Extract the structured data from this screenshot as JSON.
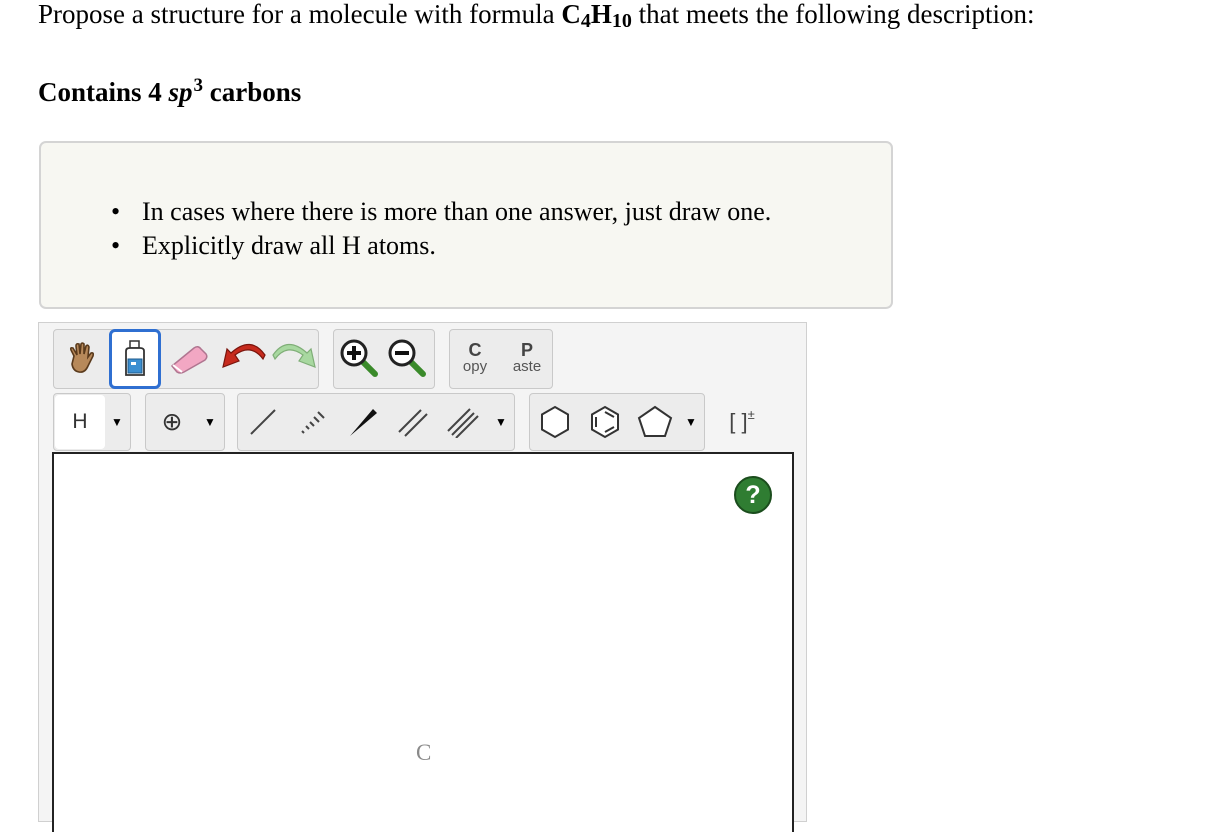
{
  "question": {
    "prefix": "Propose a structure for a molecule with formula ",
    "formula_c": "C",
    "formula_c_sub": "4",
    "formula_h": "H",
    "formula_h_sub": "10",
    "suffix": " that meets the following description:"
  },
  "description": {
    "prefix": "Contains 4 ",
    "hybrid": "sp",
    "hybrid_sup": "3",
    "suffix": " carbons"
  },
  "instructions": [
    "In cases where there is more than one answer, just draw one.",
    "Explicitly draw all H atoms."
  ],
  "toolbar": {
    "copy_top": "C",
    "copy_bottom": "opy",
    "paste_top": "P",
    "paste_bottom": "aste",
    "atom_label": "H",
    "charge_symbol": "⊕",
    "template_bracket": "[ ]",
    "template_charge": "±",
    "dropdown_caret": "▼"
  },
  "canvas": {
    "atom_label": "C",
    "help_label": "?"
  }
}
